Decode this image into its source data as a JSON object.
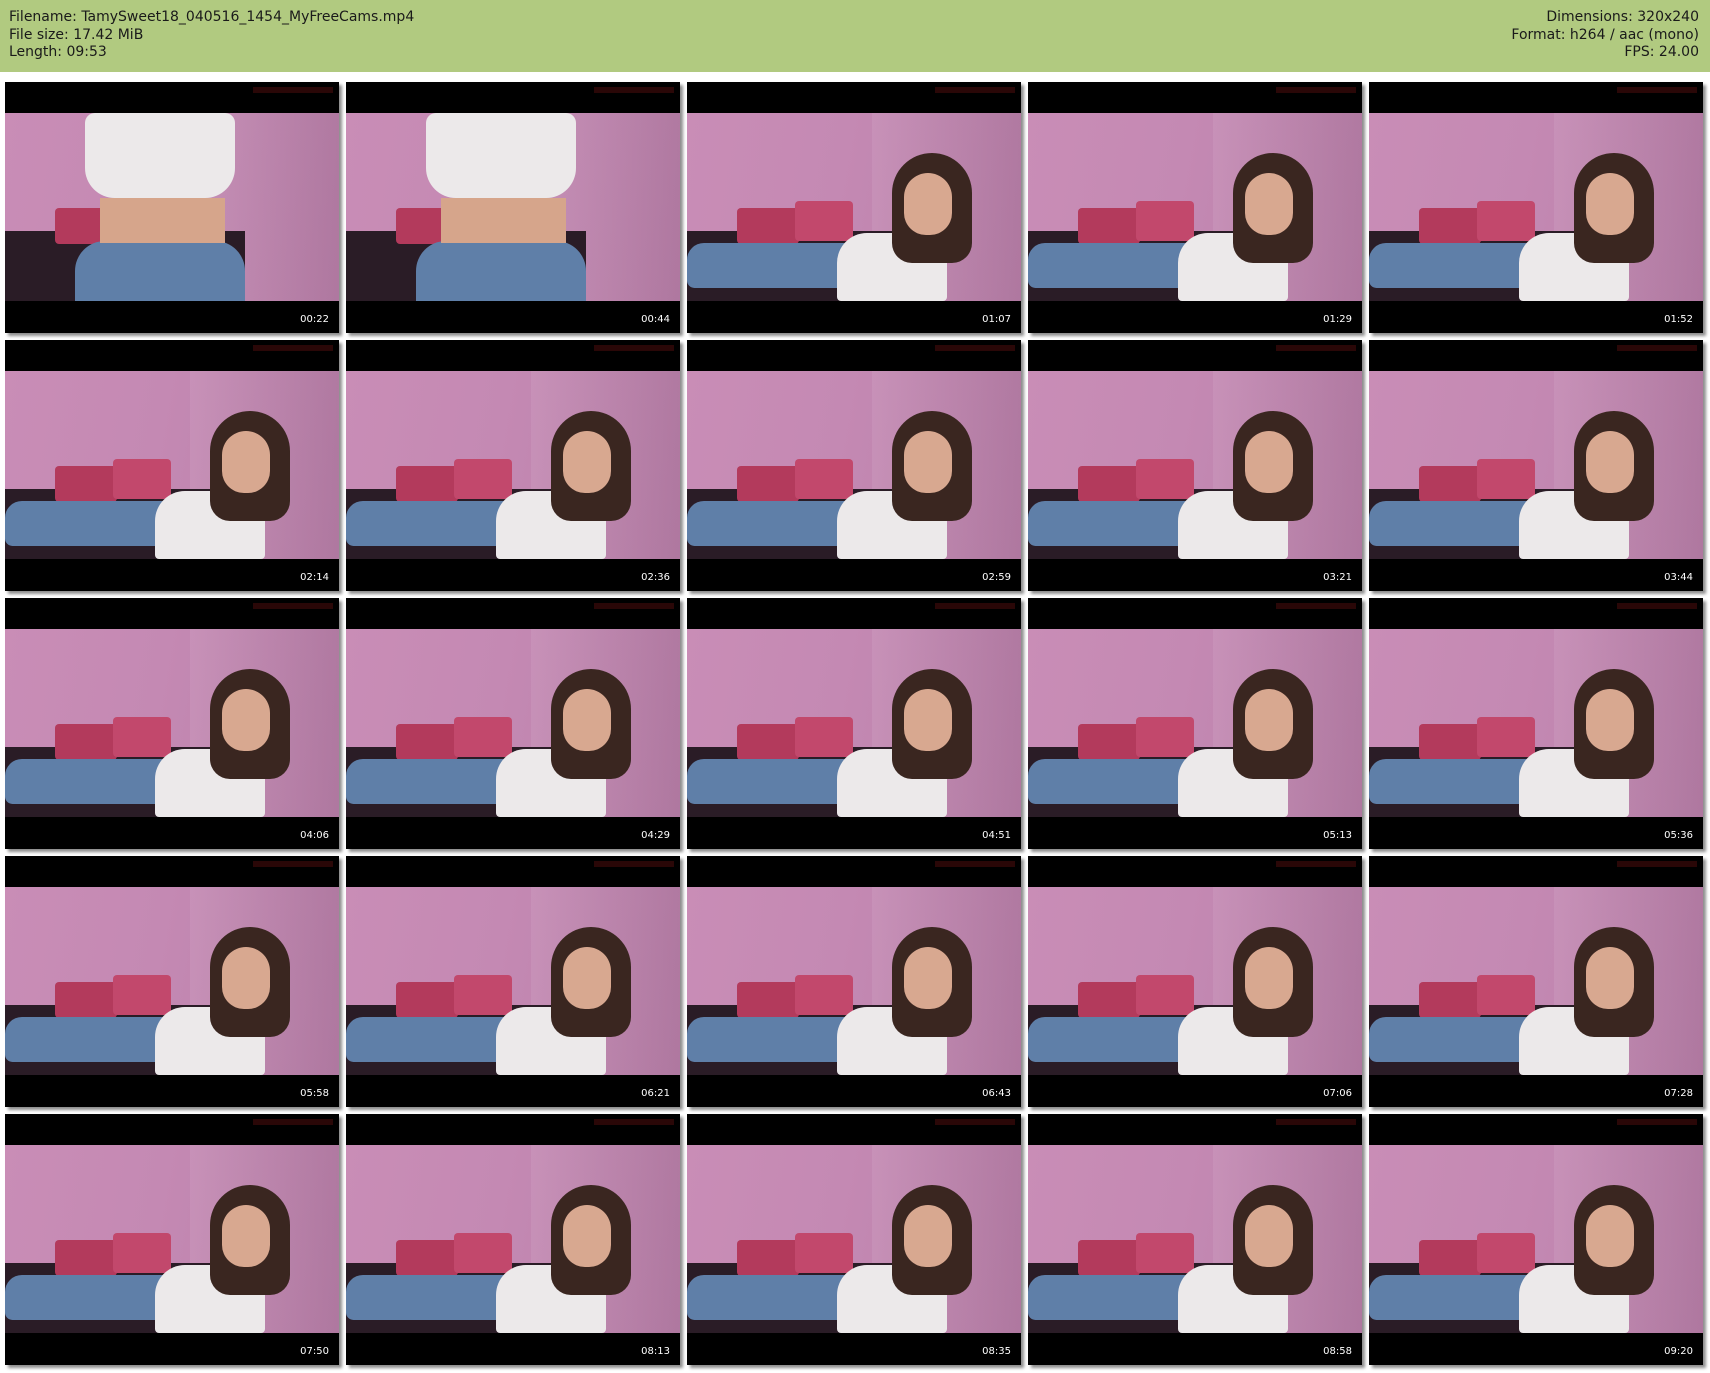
{
  "header": {
    "filename_label": "Filename:",
    "filename": "TamySweet18_040516_1454_MyFreeCams.mp4",
    "filesize_label": "File size:",
    "filesize": "17.42 MiB",
    "length_label": "Length:",
    "length": "09:53",
    "dimensions_label": "Dimensions:",
    "dimensions": "320x240",
    "format_label": "Format:",
    "format": "h264 / aac (mono)",
    "fps_label": "FPS:",
    "fps": "24.00",
    "background_color": "#b1ca80"
  },
  "thumbnails": [
    {
      "timestamp": "00:22"
    },
    {
      "timestamp": "00:44"
    },
    {
      "timestamp": "01:07"
    },
    {
      "timestamp": "01:29"
    },
    {
      "timestamp": "01:52"
    },
    {
      "timestamp": "02:14"
    },
    {
      "timestamp": "02:36"
    },
    {
      "timestamp": "02:59"
    },
    {
      "timestamp": "03:21"
    },
    {
      "timestamp": "03:44"
    },
    {
      "timestamp": "04:06"
    },
    {
      "timestamp": "04:29"
    },
    {
      "timestamp": "04:51"
    },
    {
      "timestamp": "05:13"
    },
    {
      "timestamp": "05:36"
    },
    {
      "timestamp": "05:58"
    },
    {
      "timestamp": "06:21"
    },
    {
      "timestamp": "06:43"
    },
    {
      "timestamp": "07:06"
    },
    {
      "timestamp": "07:28"
    },
    {
      "timestamp": "07:50"
    },
    {
      "timestamp": "08:13"
    },
    {
      "timestamp": "08:35"
    },
    {
      "timestamp": "08:58"
    },
    {
      "timestamp": "09:20"
    }
  ]
}
